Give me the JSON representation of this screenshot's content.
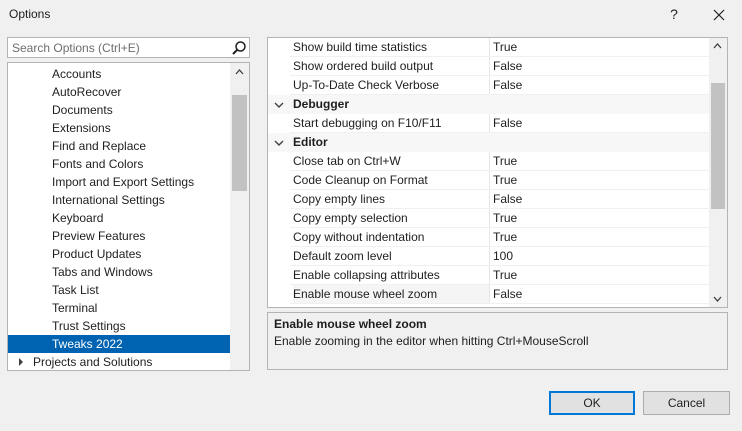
{
  "window": {
    "title": "Options",
    "help_label": "?",
    "close_label": "✕"
  },
  "search": {
    "placeholder": "Search Options (Ctrl+E)"
  },
  "tree": {
    "items": [
      {
        "label": "Accounts",
        "selected": false
      },
      {
        "label": "AutoRecover",
        "selected": false
      },
      {
        "label": "Documents",
        "selected": false
      },
      {
        "label": "Extensions",
        "selected": false
      },
      {
        "label": "Find and Replace",
        "selected": false
      },
      {
        "label": "Fonts and Colors",
        "selected": false
      },
      {
        "label": "Import and Export Settings",
        "selected": false
      },
      {
        "label": "International Settings",
        "selected": false
      },
      {
        "label": "Keyboard",
        "selected": false
      },
      {
        "label": "Preview Features",
        "selected": false
      },
      {
        "label": "Product Updates",
        "selected": false
      },
      {
        "label": "Tabs and Windows",
        "selected": false
      },
      {
        "label": "Task List",
        "selected": false
      },
      {
        "label": "Terminal",
        "selected": false
      },
      {
        "label": "Trust Settings",
        "selected": false
      },
      {
        "label": "Tweaks 2022",
        "selected": true
      }
    ],
    "top_item": {
      "label": "Projects and Solutions",
      "icon": "chevron-right-icon"
    }
  },
  "grid": {
    "rows": [
      {
        "type": "prop",
        "name": "Show build time statistics",
        "value": "True"
      },
      {
        "type": "prop",
        "name": "Show ordered build output",
        "value": "False"
      },
      {
        "type": "prop",
        "name": "Up-To-Date Check Verbose",
        "value": "False"
      },
      {
        "type": "cat",
        "name": "Debugger",
        "value": ""
      },
      {
        "type": "prop",
        "name": "Start debugging on F10/F11",
        "value": "False"
      },
      {
        "type": "cat",
        "name": "Editor",
        "value": ""
      },
      {
        "type": "prop",
        "name": "Close tab on Ctrl+W",
        "value": "True"
      },
      {
        "type": "prop",
        "name": "Code Cleanup on Format",
        "value": "True"
      },
      {
        "type": "prop",
        "name": "Copy empty lines",
        "value": "False"
      },
      {
        "type": "prop",
        "name": "Copy empty selection",
        "value": "True"
      },
      {
        "type": "prop",
        "name": "Copy without indentation",
        "value": "True"
      },
      {
        "type": "prop",
        "name": "Default zoom level",
        "value": "100"
      },
      {
        "type": "prop",
        "name": "Enable collapsing attributes",
        "value": "True"
      },
      {
        "type": "prop",
        "name": "Enable mouse wheel zoom",
        "value": "False",
        "selected": true
      }
    ]
  },
  "description": {
    "title": "Enable mouse wheel zoom",
    "text": "Enable zooming in the editor when hitting Ctrl+MouseScroll"
  },
  "buttons": {
    "ok": "OK",
    "cancel": "Cancel"
  }
}
